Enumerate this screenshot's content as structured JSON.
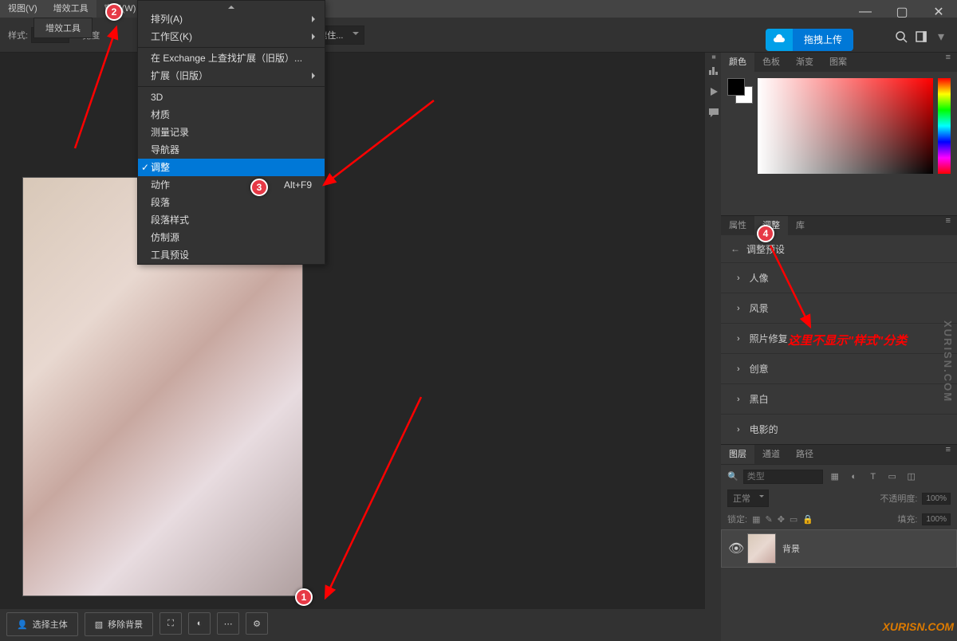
{
  "menubar": {
    "view": "视图(V)",
    "filters": "增效工具",
    "window": "窗口(W)",
    "filters2": "增效工具"
  },
  "opt": {
    "style": "样式:",
    "width": "宽度",
    "mask": "并遮住..."
  },
  "upload": "拖拽上传",
  "menu": {
    "arrange": "排列(A)",
    "workspace": "工作区(K)",
    "exchange": "在 Exchange 上查找扩展（旧版）...",
    "ext": "扩展（旧版）",
    "d3": "3D",
    "mat": "材质",
    "meas": "测量记录",
    "nav": "导航器",
    "adj": "调整",
    "act": "动作",
    "act_sc": "Alt+F9",
    "para": "段落",
    "pstyle": "段落样式",
    "clone": "仿制源",
    "tpre": "工具预设"
  },
  "tabs1": {
    "color": "颜色",
    "swatch": "色板",
    "grad": "渐变",
    "pat": "图案"
  },
  "tabs2": {
    "prop": "属性",
    "adj": "调整",
    "lib": "库"
  },
  "adj": {
    "back": "调整预设",
    "p": "人像",
    "l": "风景",
    "r": "照片修复",
    "c": "创意",
    "bw": "黑白",
    "ci": "电影的"
  },
  "tabs3": {
    "lay": "图层",
    "chan": "通道",
    "path": "路径"
  },
  "layer": {
    "search": "类型",
    "blend": "正常",
    "opacity_l": "不透明度:",
    "opacity": "100%",
    "lock": "锁定:",
    "fill_l": "填充:",
    "fill": "100%",
    "name": "背景"
  },
  "btm": {
    "sel": "选择主体",
    "rem": "移除背景"
  },
  "ann": "这里不显示\"样式\"分类",
  "wm": "XURISN.COM",
  "wmv": "XURISN.COM"
}
